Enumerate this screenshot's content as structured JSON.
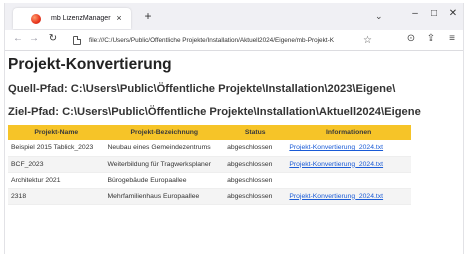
{
  "browser": {
    "tab_title": "mb LizenzManager",
    "tab_close": "×",
    "new_tab": "+",
    "tab_list": "⌄",
    "minimize": "–",
    "maximize": "□",
    "close": "✕",
    "back": "←",
    "forward": "→",
    "reload": "↻",
    "url": "file:///C:/Users/Public/Öffentliche Projekte/Installation/Aktuell2024/Eigene/mb-Projekt-K",
    "star": "☆",
    "pocket": "⊙",
    "extensions": "⇪",
    "menu": "≡"
  },
  "page": {
    "title": "Projekt-Konvertierung",
    "quell_pfad": "Quell-Pfad: C:\\Users\\Public\\Öffentliche Projekte\\Installation\\2023\\Eigene\\",
    "ziel_pfad": "Ziel-Pfad: C:\\Users\\Public\\Öffentliche Projekte\\Installation\\Aktuell2024\\Eigene"
  },
  "table": {
    "headers": [
      "Projekt-Name",
      "Projekt-Bezeichnung",
      "Status",
      "Informationen"
    ],
    "rows": [
      [
        "Beispiel 2015 Tablick_2023",
        "Neubau eines Gemeindezentrums",
        "abgeschlossen",
        "Projekt-Konvertierung_2024.txt"
      ],
      [
        "BCF_2023",
        "Weiterbildung für Tragwerksplaner",
        "abgeschlossen",
        "Projekt-Konvertierung_2024.txt"
      ],
      [
        "Architektur 2021",
        "Bürogebäude Europaallee",
        "abgeschlossen",
        ""
      ],
      [
        "2318",
        "Mehrfamilienhaus Europaallee",
        "abgeschlossen",
        "Projekt-Konvertierung_2024.txt"
      ]
    ]
  },
  "colors": {
    "header_bg": "#f6c428",
    "link": "#1a5bd6"
  }
}
